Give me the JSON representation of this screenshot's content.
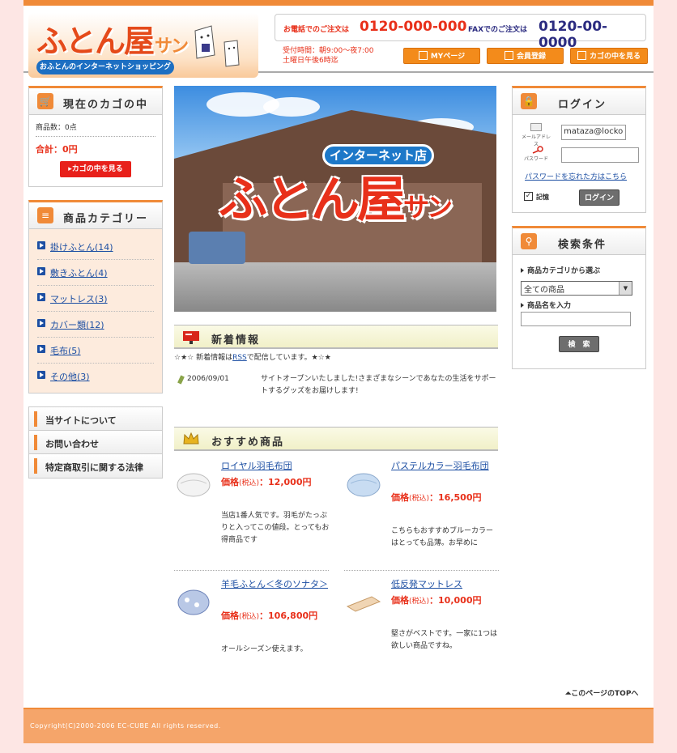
{
  "header": {
    "logo_main": "ふとん屋",
    "logo_san": "サン",
    "logo_sub": "おふとんのインターネットショッピング",
    "phone_label": "お電話でのご注文は",
    "phone_number": "0120-000-000",
    "fax_label": "FAXでのご注文は",
    "fax_number": "0120-00-0000",
    "hours_line1": "受付時間：朝9:00～夜7:00",
    "hours_line2": "土曜日午後6時迄",
    "buttons": [
      "MYページ",
      "会員登録",
      "カゴの中を見る"
    ]
  },
  "cart": {
    "title": "現在のカゴの中",
    "count": "商品数：0点",
    "total": "合計：0円",
    "button": "カゴの中を見る"
  },
  "categories": {
    "title": "商品カテゴリー",
    "items": [
      "掛けふとん(14)",
      "敷きふとん(4)",
      "マットレス(3)",
      "カバー類(12)",
      "毛布(5)",
      "その他(3)"
    ]
  },
  "nav": [
    "当サイトについて",
    "お問い合わせ",
    "特定商取引に関する法律"
  ],
  "hero": {
    "badge": "インターネット店",
    "title": "ふとん屋",
    "title_small": "サン"
  },
  "news": {
    "title": "新着情報",
    "rss_prefix": "☆★☆ 新着情報は",
    "rss_link": "RSS",
    "rss_suffix": "で配信しています。★☆★",
    "date": "2006/09/01",
    "text": "サイトオープンいたしました!さまざまなシーンであなたの生活をサポートするグッズをお届けします!"
  },
  "recommend": {
    "title": "おすすめ商品",
    "price_label": "価格",
    "tax_label": "(税込)",
    "items": [
      {
        "name": "ロイヤル羽毛布団",
        "price": "：12,000円",
        "desc": "当店1番人気です。羽毛がたっぷりと入ってこの値段。とってもお得商品です"
      },
      {
        "name": "パステルカラー羽毛布団",
        "price": "：16,500円",
        "desc": "こちらもおすすめブルーカラーはとっても品薄。お早めに"
      },
      {
        "name": "羊毛ふとん＜冬のソナタ＞",
        "price": "：106,800円",
        "desc": "オールシーズン使えます。"
      },
      {
        "name": "低反発マットレス",
        "price": "：10,000円",
        "desc": "堅さがベストです。一家に1つは欲しい商品ですね。"
      }
    ]
  },
  "login": {
    "title": "ログイン",
    "email_label": "メールアドレス",
    "password_label": "パスワード",
    "email_value": "mataza@locko",
    "forgot": "パスワードを忘れた方はこちら",
    "remember": "記憶",
    "button": "ログイン"
  },
  "search": {
    "title": "検索条件",
    "category_label": "商品カテゴリから選ぶ",
    "category_value": "全ての商品",
    "name_label": "商品名を入力",
    "button": "検　索"
  },
  "totop": "このページのTOPへ",
  "footer": "Copyright(C)2000-2006 EC-CUBE All rights reserved.",
  "colors": {
    "accent": "#f08a38",
    "price": "#e8301a",
    "link": "#1d4fa3"
  }
}
